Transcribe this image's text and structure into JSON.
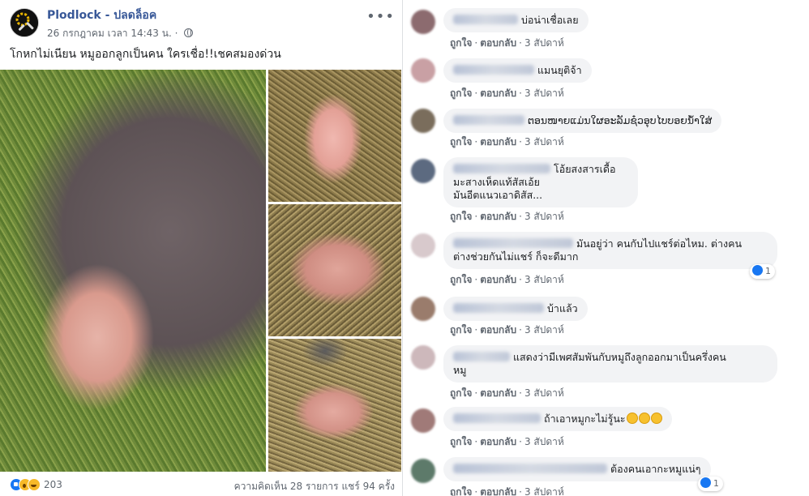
{
  "post": {
    "page_name": "Plodlock - ปลดล็อค",
    "timestamp": "26 กรกฎาคม เวลา 14:43 น.",
    "more_icon": "more-options-icon",
    "text": "โกหกไม่เนียน หมูออกลูกเป็นคน ใครเชื่อ!!เชคสมองด่วน",
    "reaction_count": "203",
    "comment_count": "ความคิดเห็น 28 รายการ",
    "share_count": "แชร์ 94 ครั้ง"
  },
  "comments": [
    {
      "text": "บ่อน่าเชื่อเลย",
      "like": "ถูกใจ",
      "reply": "ตอบกลับ",
      "time": "3 สัปดาห์",
      "avatar_color": "#8c6b6f"
    },
    {
      "text": "แมนยุติจ้า",
      "like": "ถูกใจ",
      "reply": "ตอบกลับ",
      "time": "3 สัปดาห์",
      "avatar_color": "#c9a0a4"
    },
    {
      "text": "ຕອນໜາຍແມ່ນໃຜອະລັມຊ໋ວອຸບໄບບອຍນ້ຳໃສ່",
      "like": "ถูกใจ",
      "reply": "ตอบกลับ",
      "time": "3 สัปดาห์",
      "avatar_color": "#7a6d5c"
    },
    {
      "text_lines": [
        "โอ้ยสงสารเดื้อ",
        "มะสางเห็ดแท้สัสเอ้ย",
        "มันอีตแนวเอาดิสัส..."
      ],
      "like": "ถูกใจ",
      "reply": "ตอบกลับ",
      "time": "3 สัปดาห์",
      "avatar_color": "#5c6a80"
    },
    {
      "text_lines": [
        "มันอยู่ว่า คนกับไปแชร์ต่อไหม. ต่างคน",
        "ต่างช่วยกันไม่แชร์ ก็จะดีมาก"
      ],
      "like": "ถูกใจ",
      "reply": "ตอบกลับ",
      "time": "3 สัปดาห์",
      "avatar_color": "#d8c9cc",
      "likes": "1"
    },
    {
      "text": "บ้าแล้ว",
      "like": "ถูกใจ",
      "reply": "ตอบกลับ",
      "time": "3 สัปดาห์",
      "avatar_color": "#9a7c6c"
    },
    {
      "text_lines": [
        "แสดงว่ามีเพศสัมพันกับหมูถึงลูกออกมาเป็นครึ่งคน",
        "หมู"
      ],
      "like": "ถูกใจ",
      "reply": "ตอบกลับ",
      "time": "3 สัปดาห์",
      "avatar_color": "#cdb8bb"
    },
    {
      "text": "ถ้าเอาหมูกะไม่รู้นะ",
      "like": "ถูกใจ",
      "reply": "ตอบกลับ",
      "time": "3 สัปดาห์",
      "avatar_color": "#a07a78",
      "emoji": "grinning-sweat-emoji"
    },
    {
      "text": "ต้องคนเอากะหมูแน่ๆ",
      "like": "ถูกใจ",
      "reply": "ตอบกลับ",
      "time": "3 สัปดาห์",
      "avatar_color": "#5d7a6a",
      "likes": "1"
    }
  ],
  "colors": {
    "link": "#385898",
    "bubble": "#f2f3f5",
    "like_blue": "#1877f2"
  }
}
